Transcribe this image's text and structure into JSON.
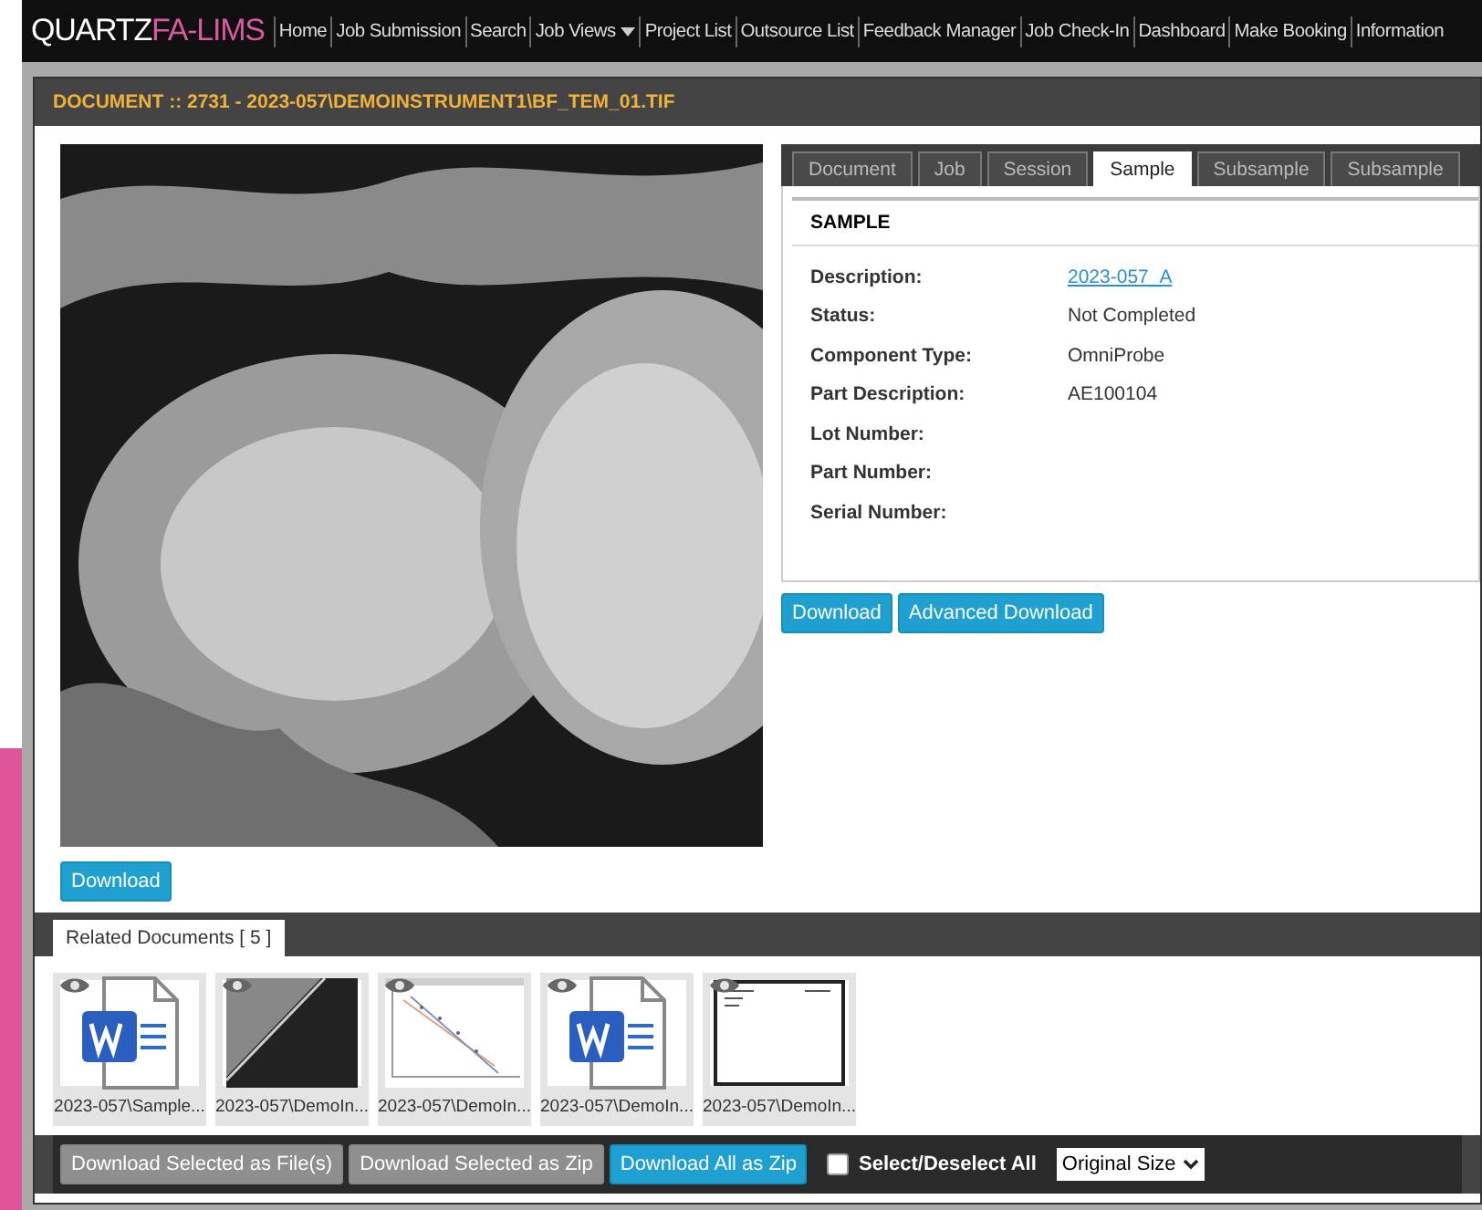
{
  "brand": {
    "first": "QUARTZ",
    "second": "FA-LIMS"
  },
  "nav": [
    {
      "label": "Home",
      "dropdown": false
    },
    {
      "label": "Job Submission",
      "dropdown": false
    },
    {
      "label": "Search",
      "dropdown": false
    },
    {
      "label": "Job Views",
      "dropdown": true
    },
    {
      "label": "Project List",
      "dropdown": false
    },
    {
      "label": "Outsource List",
      "dropdown": false
    },
    {
      "label": "Feedback Manager",
      "dropdown": false
    },
    {
      "label": "Job Check-In",
      "dropdown": false
    },
    {
      "label": "Dashboard",
      "dropdown": false
    },
    {
      "label": "Make Booking",
      "dropdown": false
    },
    {
      "label": "Information",
      "dropdown": false
    }
  ],
  "document_title": "DOCUMENT :: 2731 - 2023-057\\DEMOINSTRUMENT1\\BF_TEM_01.TIF",
  "image_download": "Download",
  "tabs": [
    {
      "label": "Document",
      "selected": false
    },
    {
      "label": "Job",
      "selected": false
    },
    {
      "label": "Session",
      "selected": false
    },
    {
      "label": "Sample",
      "selected": true
    },
    {
      "label": "Subsample",
      "selected": false
    },
    {
      "label": "Subsample",
      "selected": false
    }
  ],
  "section_title": "SAMPLE",
  "fields": [
    {
      "label": "Description:",
      "value": "2023-057_A",
      "link": true
    },
    {
      "label": "Status:",
      "value": "Not Completed",
      "link": false
    },
    {
      "label": "Component Type:",
      "value": "OmniProbe",
      "link": false
    },
    {
      "label": "Part Description:",
      "value": "AE100104",
      "link": false
    },
    {
      "label": "Lot Number:"
    },
    {
      "label": "Part Number:"
    },
    {
      "label": "Serial Number:"
    }
  ],
  "panel_buttons": [
    "Download",
    "Advanced Download"
  ],
  "related": {
    "tab": "Related Documents [  5  ]",
    "items": [
      {
        "kind": "word",
        "name": "2023-057\\Sample..."
      },
      {
        "kind": "image",
        "name": "2023-057\\DemoIn..."
      },
      {
        "kind": "chart",
        "name": "2023-057\\DemoIn..."
      },
      {
        "kind": "word",
        "name": "2023-057\\DemoIn..."
      },
      {
        "kind": "document",
        "name": "2023-057\\DemoIn..."
      }
    ]
  },
  "actions": [
    {
      "label": "Download Selected as File(s)",
      "disabled": true
    },
    {
      "label": "Download Selected as Zip",
      "disabled": true
    },
    {
      "label": "Download All as Zip",
      "disabled": false
    }
  ],
  "select_all": {
    "label": "Select/Deselect All",
    "checked": false
  },
  "size_select": {
    "value": "Original Size"
  }
}
